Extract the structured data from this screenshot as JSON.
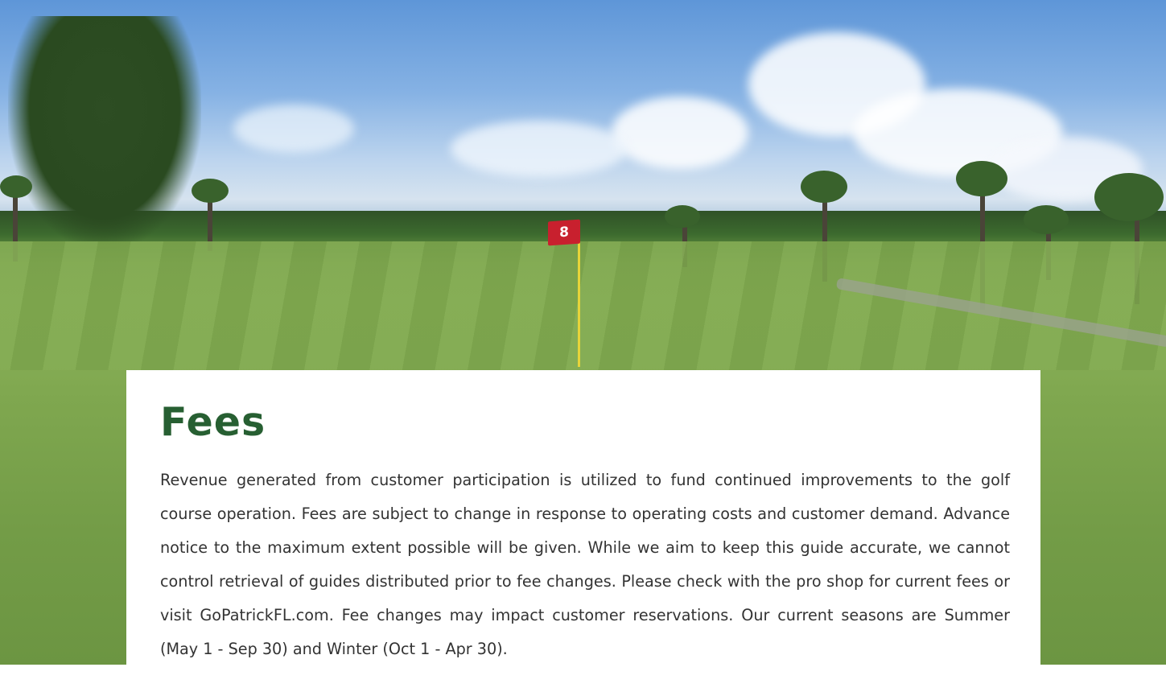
{
  "hero": {
    "flag_number": "8"
  },
  "section": {
    "title": "Fees",
    "body": "Revenue generated from customer participation is utilized to fund continued improvements to the golf course operation. Fees are subject to change in response to operating costs and customer demand. Advance notice to the maximum extent possible will be given. While we aim to keep this guide accurate, we cannot control retrieval of guides distributed prior to fee changes. Please check with the pro shop for current fees or visit GoPatrickFL.com. Fee changes may impact customer reservations. Our current seasons are Summer (May 1 - Sep 30) and Winter (Oct 1 - Apr 30)."
  },
  "colors": {
    "title_green": "#275f32",
    "body_text": "#333333",
    "card_bg": "#ffffff",
    "flag_red": "#c8202e"
  }
}
